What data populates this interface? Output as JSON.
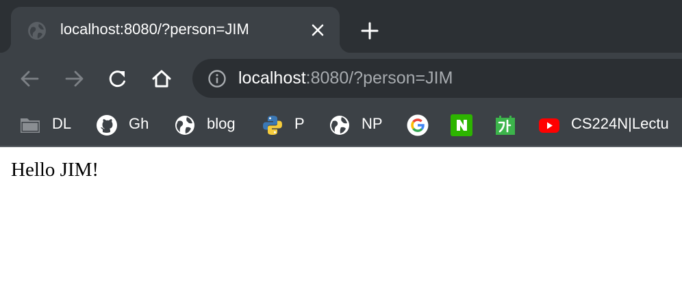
{
  "tab": {
    "title": "localhost:8080/?person=JIM",
    "favicon": "globe-icon"
  },
  "toolbar": {
    "back_icon": "back-arrow-icon",
    "forward_icon": "forward-arrow-icon",
    "reload_icon": "reload-icon",
    "home_icon": "home-icon"
  },
  "omnibox": {
    "host": "localhost",
    "rest": ":8080/?person=JIM",
    "security_icon": "info-icon"
  },
  "bookmarks": [
    {
      "label": "DL",
      "icon": "folder-icon"
    },
    {
      "label": "Gh",
      "icon": "github-icon"
    },
    {
      "label": "blog",
      "icon": "globe-icon"
    },
    {
      "label": "P",
      "icon": "python-icon"
    },
    {
      "label": "NP",
      "icon": "globe-icon"
    },
    {
      "label": "",
      "icon": "google-icon"
    },
    {
      "label": "",
      "icon": "naver-icon"
    },
    {
      "label": "",
      "icon": "korean-dictionary-icon"
    },
    {
      "label": "CS224N|Lectu",
      "icon": "youtube-icon"
    }
  ],
  "page": {
    "text": "Hello JIM!"
  },
  "colors": {
    "tabstrip_bg": "#2c3034",
    "toolbar_bg": "#3c4146",
    "omnibox_bg": "#2b2f33",
    "url_host": "#ffffff",
    "url_rest": "#a7abaf",
    "naver_green": "#2db400",
    "youtube_red": "#ff0000"
  }
}
